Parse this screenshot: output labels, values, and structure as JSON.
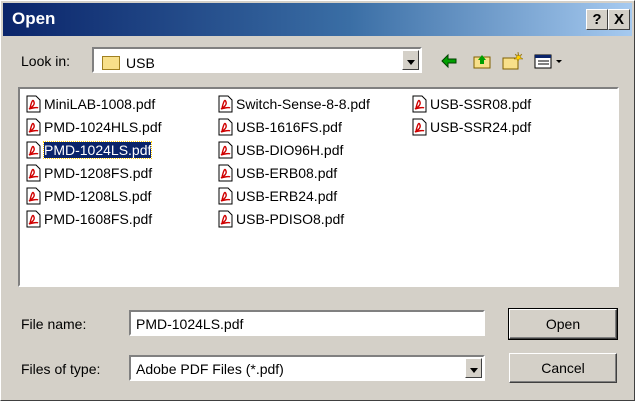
{
  "window": {
    "title": "Open",
    "help_button": "?",
    "close_button": "X"
  },
  "look_in": {
    "label": "Look in:",
    "value": "USB"
  },
  "toolbar": {
    "back_icon": "arrow-left-icon",
    "up_icon": "up-folder-icon",
    "new_folder_icon": "new-folder-icon",
    "view_icon": "view-menu-icon"
  },
  "files": [
    {
      "name": "MiniLAB-1008.pdf"
    },
    {
      "name": "PMD-1024HLS.pdf"
    },
    {
      "name": "PMD-1024LS.pdf",
      "selected": true
    },
    {
      "name": "PMD-1208FS.pdf"
    },
    {
      "name": "PMD-1208LS.pdf"
    },
    {
      "name": "PMD-1608FS.pdf"
    },
    {
      "name": "Switch-Sense-8-8.pdf"
    },
    {
      "name": "USB-1616FS.pdf"
    },
    {
      "name": "USB-DIO96H.pdf"
    },
    {
      "name": "USB-ERB08.pdf"
    },
    {
      "name": "USB-ERB24.pdf"
    },
    {
      "name": "USB-PDISO8.pdf"
    },
    {
      "name": "USB-SSR08.pdf"
    },
    {
      "name": "USB-SSR24.pdf"
    }
  ],
  "file_name": {
    "label": "File name:",
    "value": "PMD-1024LS.pdf"
  },
  "file_type": {
    "label": "Files of type:",
    "value": "Adobe PDF Files (*.pdf)"
  },
  "buttons": {
    "open": "Open",
    "cancel": "Cancel"
  }
}
